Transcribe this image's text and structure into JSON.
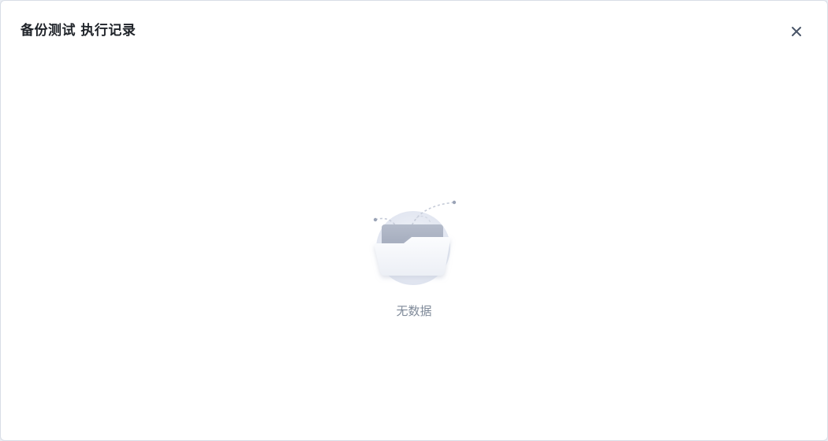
{
  "dialog": {
    "title": "备份测试 执行记录",
    "close_icon": "close-icon"
  },
  "empty_state": {
    "illustration_icon": "empty-folder-icon",
    "text": "无数据"
  },
  "colors": {
    "title": "#1f2329",
    "muted_text": "#7f8a99",
    "close_icon": "#4a5568",
    "illustration_circle": "#e7eaf3",
    "folder_back": "#a3abbd",
    "folder_front": "#f3f5f9"
  }
}
